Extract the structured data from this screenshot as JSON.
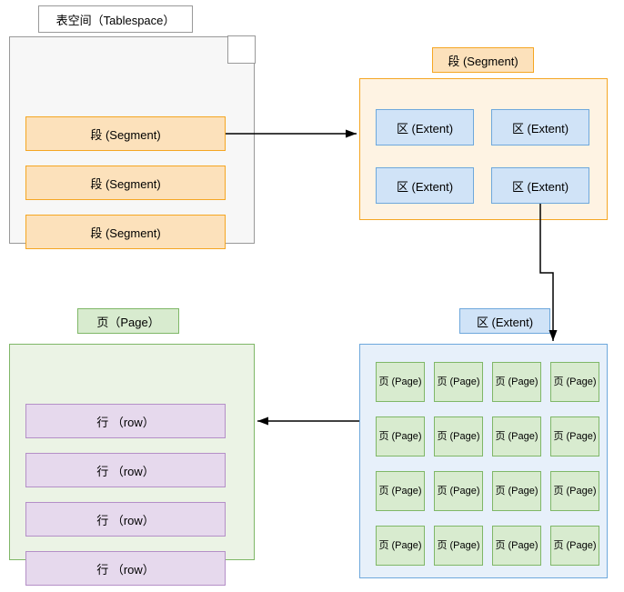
{
  "tablespace": {
    "label": "表空间（Tablespace）",
    "segments": [
      "段 (Segment)",
      "段 (Segment)",
      "段 (Segment)"
    ]
  },
  "segment": {
    "label": "段 (Segment)",
    "extents": [
      "区 (Extent)",
      "区 (Extent)",
      "区 (Extent)",
      "区 (Extent)"
    ]
  },
  "extent": {
    "label": "区 (Extent)",
    "page_label": "页 (Page)",
    "page_count": 16
  },
  "page": {
    "label": "页（Page）",
    "rows": [
      "行 （row）",
      "行 （row）",
      "行 （row）",
      "行 （row）"
    ]
  }
}
